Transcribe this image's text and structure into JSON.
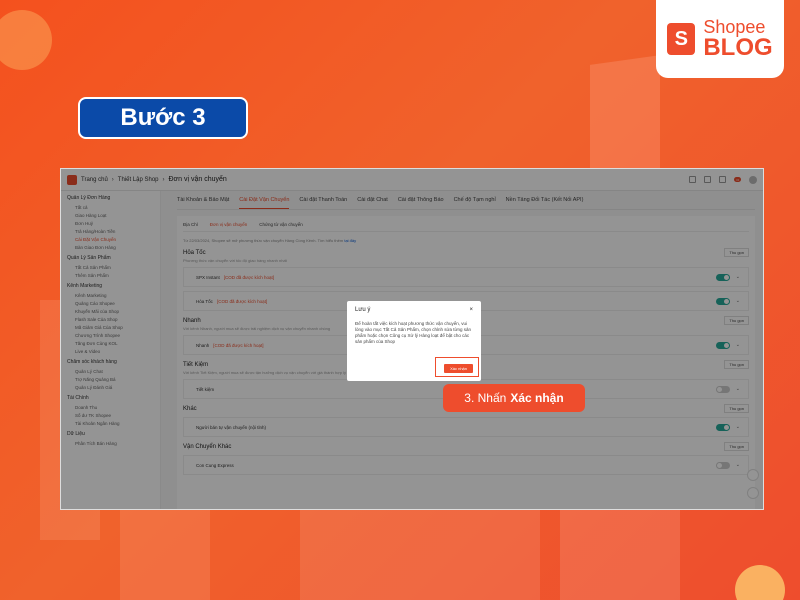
{
  "brand": {
    "bag_letter": "S",
    "shopee": "Shopee",
    "blog": "BLOG"
  },
  "step_label": "Bước 3",
  "screenshot": {
    "breadcrumb": [
      "Trang chủ",
      "Thiết Lập Shop",
      "Đơn vị vận chuyển"
    ],
    "sidebar": [
      {
        "head": "Quản Lý Đơn Hàng",
        "items": [
          "Tất cả",
          "Giao Hàng Loạt",
          "Đơn Huỷ",
          "Trả Hàng/Hoàn Tiền",
          "Cài Đặt Vận Chuyển",
          "Bàn Giao Đơn Hàng"
        ],
        "active": 4
      },
      {
        "head": "Quản Lý Sản Phẩm",
        "items": [
          "Tất Cả Sản Phẩm",
          "Thêm Sản Phẩm"
        ],
        "active": -1
      },
      {
        "head": "Kênh Marketing",
        "items": [
          "Kênh Marketing",
          "Quảng Cáo Shopee",
          "Khuyến Mãi của Shop",
          "Flash Sale Của Shop",
          "Mã Giảm Giá Của Shop",
          "Chương Trình Shopee",
          "Tăng Đơn Cùng KOL",
          "Live & Video"
        ],
        "active": -1
      },
      {
        "head": "Chăm sóc khách hàng",
        "items": [
          "Quản Lý Chat",
          "Trợ Năng Quảng Bá",
          "Quản Lý Đánh Giá"
        ],
        "active": -1
      },
      {
        "head": "Tài Chính",
        "items": [
          "Doanh Thu",
          "Số dư TK Shopee",
          "Tài Khoản Ngân Hàng"
        ],
        "active": -1
      },
      {
        "head": "Dữ Liệu",
        "items": [
          "Phân Tích Bán Hàng"
        ],
        "active": -1
      }
    ],
    "top_tabs": [
      "Tài Khoản & Bảo Mật",
      "Cài Đặt Vận Chuyển",
      "Cài đặt Thanh Toán",
      "Cài đặt Chat",
      "Cài đặt Thông Báo",
      "Chế độ Tạm nghỉ",
      "Nền Tảng Đối Tác (Kết Nối API)"
    ],
    "top_tab_active": 1,
    "sub_tabs": [
      "Địa Chỉ",
      "Đơn vị vận chuyển",
      "Chứng từ vận chuyển"
    ],
    "sub_tab_active": 1,
    "notice": "Từ 22/03/2024, Shopee sẽ mở phương thức vận chuyển Hàng Cồng Kềnh. Tìm hiểu thêm",
    "notice_link": "tại đây",
    "sections": [
      {
        "title": "Hỏa Tốc",
        "desc": "Phương thức vận chuyển với tốc độ giao hàng nhanh nhất",
        "rows": [
          {
            "name": "SPX Instant",
            "tag": "[COD đã được kích hoạt]",
            "on": true
          },
          {
            "name": "Hỏa Tốc",
            "tag": "[COD đã được kích hoạt]",
            "on": true
          }
        ]
      },
      {
        "title": "Nhanh",
        "desc": "Với kênh Nhanh, người mua sẽ được trải nghiệm dịch vụ vận chuyển nhanh chóng",
        "rows": [
          {
            "name": "Nhanh",
            "tag": "[COD đã được kích hoạt]",
            "on": true
          }
        ]
      },
      {
        "title": "Tiết Kiệm",
        "desc": "Với kênh Tiết Kiệm, người mua sẽ được tận hưởng dịch vụ vận chuyển với giá thành hợp lý",
        "rows": [
          {
            "name": "Tiết kiệm",
            "tag": "",
            "on": false
          }
        ]
      },
      {
        "title": "Khác",
        "desc": "",
        "rows": [
          {
            "name": "Người bán tự vận chuyển (nội tỉnh)",
            "tag": "",
            "on": true
          }
        ]
      },
      {
        "title": "Vận Chuyển Khác",
        "desc": "",
        "rows": [
          {
            "name": "Con Cung Express",
            "tag": "",
            "on": false
          }
        ]
      }
    ],
    "dropdown_label": "Thu gọn",
    "modal": {
      "title": "Lưu ý",
      "close": "×",
      "body": "Để hoàn tất việc kích hoạt phương thức vận chuyển, vui lòng vào mục Tất Cả Sản Phẩm, chọn chỉnh sửa từng sản phẩm hoặc chọn Công cụ Xử lý Hàng loạt để bật cho các sản phẩm của Shop",
      "confirm": "Xác nhận"
    }
  },
  "callout": {
    "prefix": "3. Nhấn",
    "action": "Xác nhận"
  },
  "colors": {
    "brand_orange": "#ee4d2d",
    "step_blue": "#0b4aa8",
    "toggle_on": "#26aa99"
  }
}
